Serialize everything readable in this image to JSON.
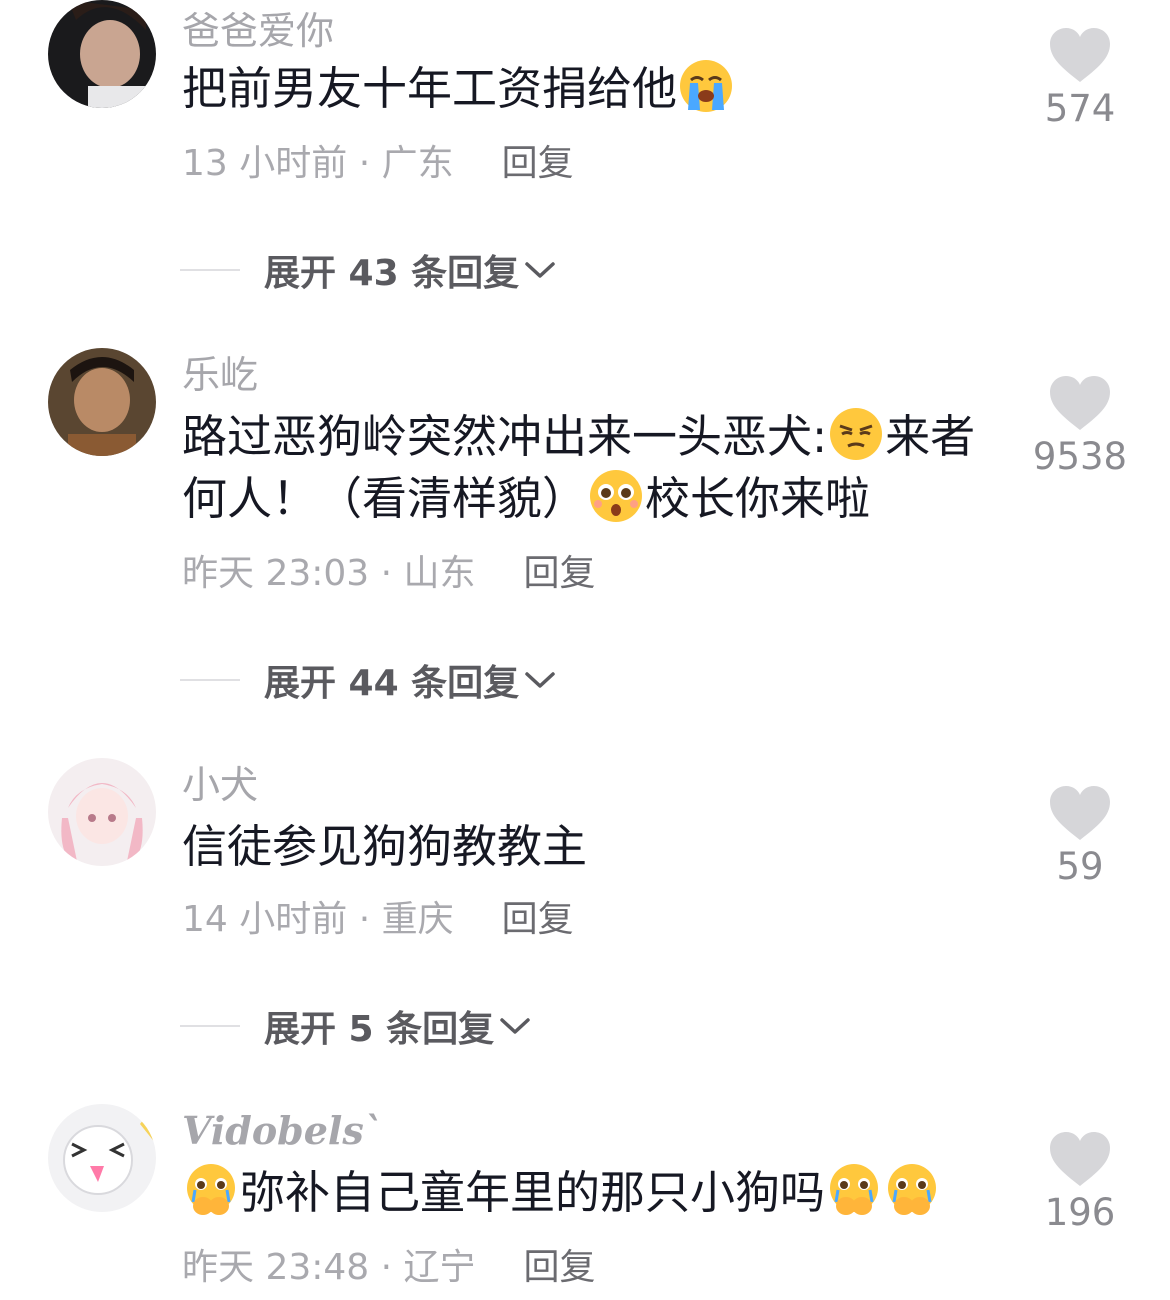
{
  "comments": [
    {
      "username": "爸爸爱你",
      "text": "把前男友十年工资捐给他",
      "time": "13 小时前 · 广东",
      "reply": "回复",
      "likes": "574",
      "expand": "展开 43 条回复"
    },
    {
      "username": "乐屹",
      "text1": "路过恶狗岭突然冲出来一头恶犬:",
      "text2": "来者",
      "text3": "何人！（看清样貌）",
      "text4": "校长你来啦",
      "time": "昨天 23:03 · 山东",
      "reply": "回复",
      "likes": "9538",
      "expand": "展开 44 条回复"
    },
    {
      "username": "小犬",
      "text": "信徒参见狗狗教教主",
      "time": "14 小时前 · 重庆",
      "reply": "回复",
      "likes": "59",
      "expand": "展开 5 条回复"
    },
    {
      "username": "Vidobels`",
      "text": "弥补自己童年里的那只小狗吗",
      "time": "昨天 23:48 · 辽宁",
      "reply": "回复",
      "likes": "196"
    }
  ],
  "icons": {
    "heart": "heart-icon",
    "chevron": "chevron-down-icon",
    "emoji_crying": "loudly-crying-emoji",
    "emoji_smug": "smug-face-emoji",
    "emoji_shocked": "shocked-face-emoji",
    "emoji_teary": "teary-hands-over-mouth-emoji"
  },
  "colors": {
    "text": "#161823",
    "meta": "#a9a9ae",
    "heart": "#d6d6d9",
    "emoji_yellow": "#ffc83d"
  }
}
